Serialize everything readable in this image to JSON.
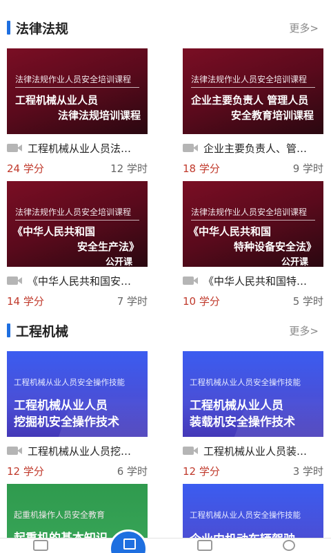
{
  "sections": [
    {
      "title": "法律法规",
      "more": "更多>",
      "cards": [
        {
          "sub": "法律法规作业人员安全培训课程",
          "lines": [
            "工程机械从业人员",
            "法律法规培训课程",
            ""
          ],
          "title": "工程机械从业人员法…",
          "credit": "24 学分",
          "hours": "12 学时"
        },
        {
          "sub": "法律法规作业人员安全培训课程",
          "lines": [
            "企业主要负责人 管理人员",
            "安全教育培训课程",
            ""
          ],
          "title": "企业主要负责人、管…",
          "credit": "18 学分",
          "hours": "9 学时"
        },
        {
          "sub": "法律法规作业人员安全培训课程",
          "lines": [
            "《中华人民共和国",
            "安全生产法》",
            "公开课"
          ],
          "title": "《中华人民共和国安…",
          "credit": "14 学分",
          "hours": "7 学时"
        },
        {
          "sub": "法律法规作业人员安全培训课程",
          "lines": [
            "《中华人民共和国",
            "特种设备安全法》",
            "公开课"
          ],
          "title": "《中华人民共和国特…",
          "credit": "10 学分",
          "hours": "5 学时"
        }
      ]
    },
    {
      "title": "工程机械",
      "more": "更多>",
      "cards": [
        {
          "sub": "工程机械从业人员安全操作技能",
          "lines": [
            "工程机械从业人员",
            "挖掘机安全操作技术"
          ],
          "title": "工程机械从业人员挖…",
          "credit": "12 学分",
          "hours": "6 学时"
        },
        {
          "sub": "工程机械从业人员安全操作技能",
          "lines": [
            "工程机械从业人员",
            "装载机安全操作技术"
          ],
          "title": "工程机械从业人员装…",
          "credit": "12 学分",
          "hours": "3 学时"
        },
        {
          "sub": "起重机操作人员安全教育",
          "lines": [
            "起重机的基本知识"
          ],
          "title": "",
          "credit": "",
          "hours": ""
        },
        {
          "sub": "工程机械从业人员安全操作技能",
          "lines": [
            "企业内机动车辆驾驶"
          ],
          "title": "",
          "credit": "",
          "hours": ""
        }
      ]
    }
  ],
  "colors": {
    "accent": "#1e6fe0",
    "credit": "#c0392b"
  },
  "icons": {
    "card": "video-camera-icon",
    "tab_center": "book-icon"
  }
}
